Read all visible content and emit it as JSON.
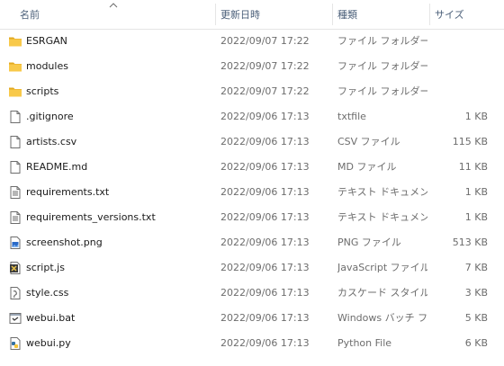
{
  "header": {
    "name_label": "名前",
    "date_label": "更新日時",
    "type_label": "種類",
    "size_label": "サイズ",
    "sort_icon": "chevron-up-icon"
  },
  "files": [
    {
      "name": "ESRGAN",
      "date": "2022/09/07 17:22",
      "type": "ファイル フォルダー",
      "size": "",
      "icon": "folder-icon"
    },
    {
      "name": "modules",
      "date": "2022/09/07 17:22",
      "type": "ファイル フォルダー",
      "size": "",
      "icon": "folder-icon"
    },
    {
      "name": "scripts",
      "date": "2022/09/07 17:22",
      "type": "ファイル フォルダー",
      "size": "",
      "icon": "folder-icon"
    },
    {
      "name": ".gitignore",
      "date": "2022/09/06 17:13",
      "type": "txtfile",
      "size": "1 KB",
      "icon": "blank-file-icon"
    },
    {
      "name": "artists.csv",
      "date": "2022/09/06 17:13",
      "type": "CSV ファイル",
      "size": "115 KB",
      "icon": "blank-file-icon"
    },
    {
      "name": "README.md",
      "date": "2022/09/06 17:13",
      "type": "MD ファイル",
      "size": "11 KB",
      "icon": "blank-file-icon"
    },
    {
      "name": "requirements.txt",
      "date": "2022/09/06 17:13",
      "type": "テキスト ドキュメント",
      "size": "1 KB",
      "icon": "text-file-icon"
    },
    {
      "name": "requirements_versions.txt",
      "date": "2022/09/06 17:13",
      "type": "テキスト ドキュメント",
      "size": "1 KB",
      "icon": "text-file-icon"
    },
    {
      "name": "screenshot.png",
      "date": "2022/09/06 17:13",
      "type": "PNG ファイル",
      "size": "513 KB",
      "icon": "image-file-icon"
    },
    {
      "name": "script.js",
      "date": "2022/09/06 17:13",
      "type": "JavaScript ファイル",
      "size": "7 KB",
      "icon": "script-file-icon"
    },
    {
      "name": "style.css",
      "date": "2022/09/06 17:13",
      "type": "カスケード スタイル シ...",
      "size": "3 KB",
      "icon": "css-file-icon"
    },
    {
      "name": "webui.bat",
      "date": "2022/09/06 17:13",
      "type": "Windows バッチ ファ...",
      "size": "5 KB",
      "icon": "batch-file-icon"
    },
    {
      "name": "webui.py",
      "date": "2022/09/06 17:13",
      "type": "Python File",
      "size": "6 KB",
      "icon": "python-file-icon"
    }
  ],
  "colors": {
    "folder": "#f8c94a",
    "folder_dark": "#e3a920",
    "header_text": "#4c607a",
    "secondary_text": "#6d6d6d"
  }
}
